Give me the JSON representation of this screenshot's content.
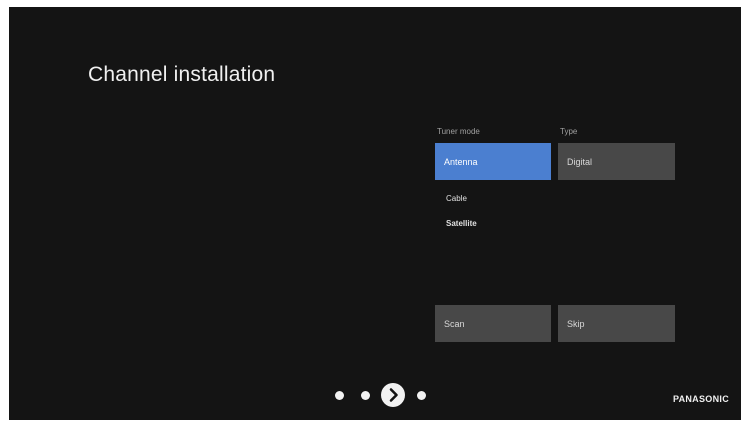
{
  "page": {
    "title": "Channel installation"
  },
  "tuner_mode": {
    "label": "Tuner mode",
    "selected": "Antenna",
    "options": [
      "Cable",
      "Satellite"
    ]
  },
  "type": {
    "label": "Type",
    "value": "Digital"
  },
  "actions": {
    "scan_label": "Scan",
    "skip_label": "Skip"
  },
  "pagination": {
    "total_steps": 4,
    "current_step": 3
  },
  "brand": {
    "name": "PANASONIC"
  },
  "colors": {
    "background": "#141414",
    "accent": "#4b7fd0",
    "tile": "#484848",
    "text": "#f0f0f0"
  },
  "icons": {
    "next": "chevron-right-icon"
  }
}
